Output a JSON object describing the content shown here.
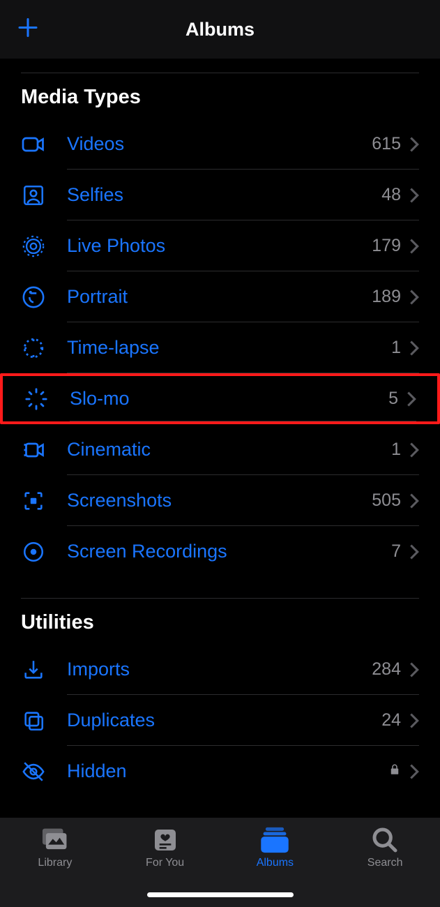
{
  "header": {
    "title": "Albums"
  },
  "sections": {
    "mediaTypes": {
      "title": "Media Types",
      "items": [
        {
          "label": "Videos",
          "count": "615"
        },
        {
          "label": "Selfies",
          "count": "48"
        },
        {
          "label": "Live Photos",
          "count": "179"
        },
        {
          "label": "Portrait",
          "count": "189"
        },
        {
          "label": "Time-lapse",
          "count": "1"
        },
        {
          "label": "Slo-mo",
          "count": "5"
        },
        {
          "label": "Cinematic",
          "count": "1"
        },
        {
          "label": "Screenshots",
          "count": "505"
        },
        {
          "label": "Screen Recordings",
          "count": "7"
        }
      ]
    },
    "utilities": {
      "title": "Utilities",
      "items": [
        {
          "label": "Imports",
          "count": "284"
        },
        {
          "label": "Duplicates",
          "count": "24"
        },
        {
          "label": "Hidden"
        }
      ]
    }
  },
  "tabs": {
    "library": "Library",
    "forYou": "For You",
    "albums": "Albums",
    "search": "Search"
  }
}
